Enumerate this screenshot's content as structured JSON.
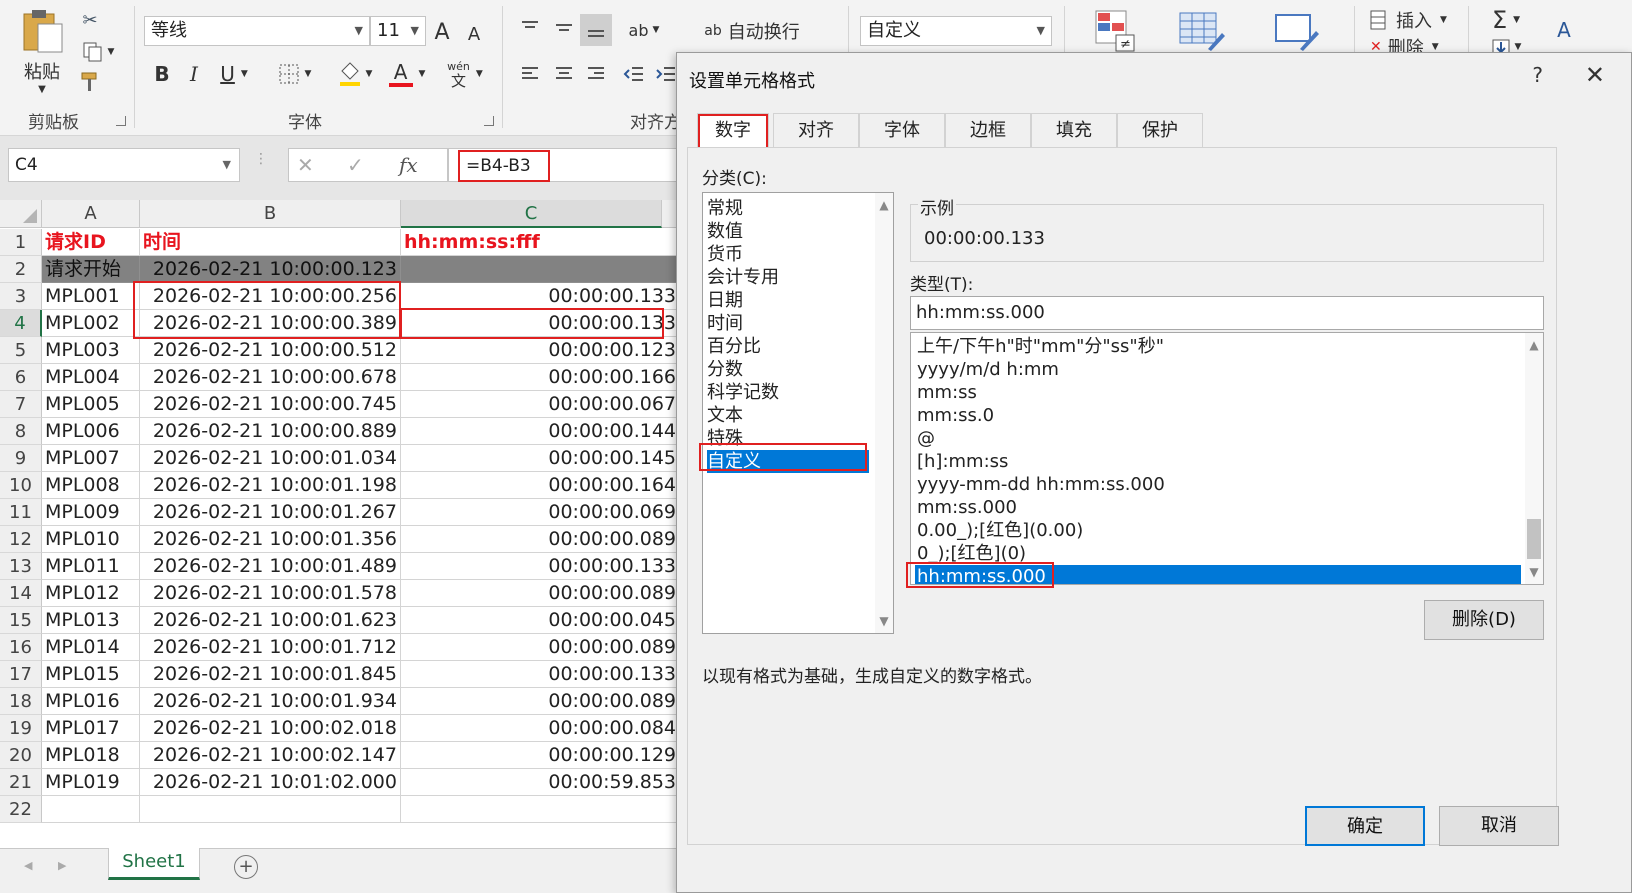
{
  "ribbon": {
    "paste_label": "粘贴",
    "clipboard_label": "剪贴板",
    "font_name": "等线",
    "font_size": "11",
    "font_label": "字体",
    "grow_font": "A",
    "shrink_font": "A",
    "bold": "B",
    "italic": "I",
    "underline": "U",
    "font_color_letter": "A",
    "phonetic_top": "wén",
    "phonetic_bottom": "文",
    "wrap_text_label": "自动换行",
    "align_label": "对齐方",
    "wrap_icon": "ab",
    "number_format": "自定义",
    "insert_label": "插入",
    "delete_label": "删除",
    "sum_icon": "Σ",
    "sort_icon": "A"
  },
  "formula_bar": {
    "name_box": "C4",
    "cancel_icon": "✕",
    "enter_icon": "✓",
    "fx_label": "fx",
    "formula": "=B4-B3"
  },
  "sheet": {
    "columns": [
      "A",
      "B",
      "C"
    ],
    "rows": [
      {
        "num": "1",
        "a": "请求ID",
        "b": "时间",
        "c": "hh:mm:ss:fff"
      },
      {
        "num": "2",
        "a": "请求开始",
        "b": "2026-02-21 10:00:00.123",
        "c": ""
      },
      {
        "num": "3",
        "a": "MPL001",
        "b": "2026-02-21 10:00:00.256",
        "c": "00:00:00.133"
      },
      {
        "num": "4",
        "a": "MPL002",
        "b": "2026-02-21 10:00:00.389",
        "c": "00:00:00.133"
      },
      {
        "num": "5",
        "a": "MPL003",
        "b": "2026-02-21 10:00:00.512",
        "c": "00:00:00.123"
      },
      {
        "num": "6",
        "a": "MPL004",
        "b": "2026-02-21 10:00:00.678",
        "c": "00:00:00.166"
      },
      {
        "num": "7",
        "a": "MPL005",
        "b": "2026-02-21 10:00:00.745",
        "c": "00:00:00.067"
      },
      {
        "num": "8",
        "a": "MPL006",
        "b": "2026-02-21 10:00:00.889",
        "c": "00:00:00.144"
      },
      {
        "num": "9",
        "a": "MPL007",
        "b": "2026-02-21 10:00:01.034",
        "c": "00:00:00.145"
      },
      {
        "num": "10",
        "a": "MPL008",
        "b": "2026-02-21 10:00:01.198",
        "c": "00:00:00.164"
      },
      {
        "num": "11",
        "a": "MPL009",
        "b": "2026-02-21 10:00:01.267",
        "c": "00:00:00.069"
      },
      {
        "num": "12",
        "a": "MPL010",
        "b": "2026-02-21 10:00:01.356",
        "c": "00:00:00.089"
      },
      {
        "num": "13",
        "a": "MPL011",
        "b": "2026-02-21 10:00:01.489",
        "c": "00:00:00.133"
      },
      {
        "num": "14",
        "a": "MPL012",
        "b": "2026-02-21 10:00:01.578",
        "c": "00:00:00.089"
      },
      {
        "num": "15",
        "a": "MPL013",
        "b": "2026-02-21 10:00:01.623",
        "c": "00:00:00.045"
      },
      {
        "num": "16",
        "a": "MPL014",
        "b": "2026-02-21 10:00:01.712",
        "c": "00:00:00.089"
      },
      {
        "num": "17",
        "a": "MPL015",
        "b": "2026-02-21 10:00:01.845",
        "c": "00:00:00.133"
      },
      {
        "num": "18",
        "a": "MPL016",
        "b": "2026-02-21 10:00:01.934",
        "c": "00:00:00.089"
      },
      {
        "num": "19",
        "a": "MPL017",
        "b": "2026-02-21 10:00:02.018",
        "c": "00:00:00.084"
      },
      {
        "num": "20",
        "a": "MPL018",
        "b": "2026-02-21 10:00:02.147",
        "c": "00:00:00.129"
      },
      {
        "num": "21",
        "a": "MPL019",
        "b": "2026-02-21 10:01:02.000",
        "c": "00:00:59.853"
      },
      {
        "num": "22",
        "a": "",
        "b": "",
        "c": ""
      }
    ],
    "tab_name": "Sheet1",
    "add_sheet": "+",
    "nav_prev": "◀",
    "nav_next": "▶"
  },
  "dialog": {
    "title": "设置单元格格式",
    "help": "?",
    "close": "✕",
    "tabs": [
      "数字",
      "对齐",
      "字体",
      "边框",
      "填充",
      "保护"
    ],
    "category_label": "分类(C):",
    "categories": [
      "常规",
      "数值",
      "货币",
      "会计专用",
      "日期",
      "时间",
      "百分比",
      "分数",
      "科学记数",
      "文本",
      "特殊",
      "自定义"
    ],
    "selected_category": "自定义",
    "sample_label": "示例",
    "sample_value": "00:00:00.133",
    "type_label": "类型(T):",
    "type_value": "hh:mm:ss.000",
    "formats": [
      "上午/下午h\"时\"mm\"分\"ss\"秒\"",
      "yyyy/m/d h:mm",
      "mm:ss",
      "mm:ss.0",
      "@",
      "[h]:mm:ss",
      "yyyy-mm-dd hh:mm:ss.000",
      "mm:ss.000",
      "0.00_);[红色](0.00)",
      "0_);[红色](0)",
      "hh:mm:ss.000"
    ],
    "delete_button": "删除(D)",
    "hint": "以现有格式为基础，生成自定义的数字格式。",
    "ok_button": "确定",
    "cancel_button": "取消"
  },
  "colors": {
    "accent_green": "#217346",
    "highlight_red": "#e02020",
    "selection_blue": "#0078d7",
    "header_gray": "#828282"
  }
}
